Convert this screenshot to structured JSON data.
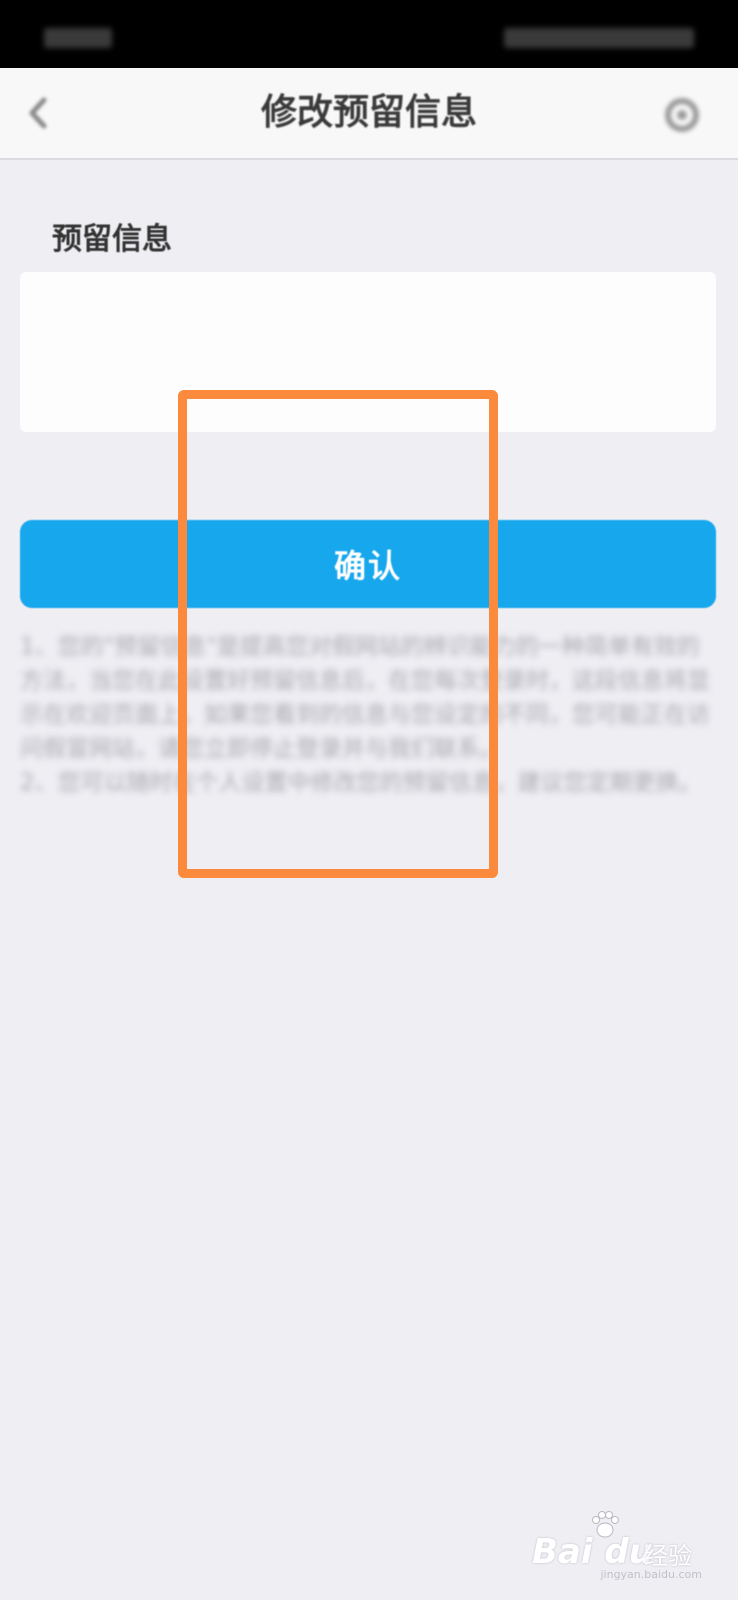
{
  "status_bar": {
    "left_text": "",
    "right_text": ""
  },
  "nav": {
    "back_icon": "chevron-left-icon",
    "title": "修改预留信息",
    "settings_icon": "gear-icon"
  },
  "form": {
    "section_label": "预留信息",
    "input_value": "",
    "input_placeholder": ""
  },
  "confirm_button": {
    "label": "确认",
    "color": "#16a7ec"
  },
  "tips": [
    "1、您的\"预留信息\"是提高您对假网站的辨识能力的一种简单有效的方法，当您在此设置好预留信息后，在您每次登录时，这段信息将显示在欢迎页面上，如果您看到的信息与您设定的不同，您可能正在访问假冒网站，请您立即停止登录并与我们联系。",
    "2、您可以随时在个人设置中修改您的预留信息，建议您定期更换。"
  ],
  "highlight": {
    "color": "#fb8a3c"
  },
  "watermark": {
    "logo_text": "Bai du",
    "jingyan_text": "经验",
    "url_text": "jingyan.baidu.com"
  }
}
